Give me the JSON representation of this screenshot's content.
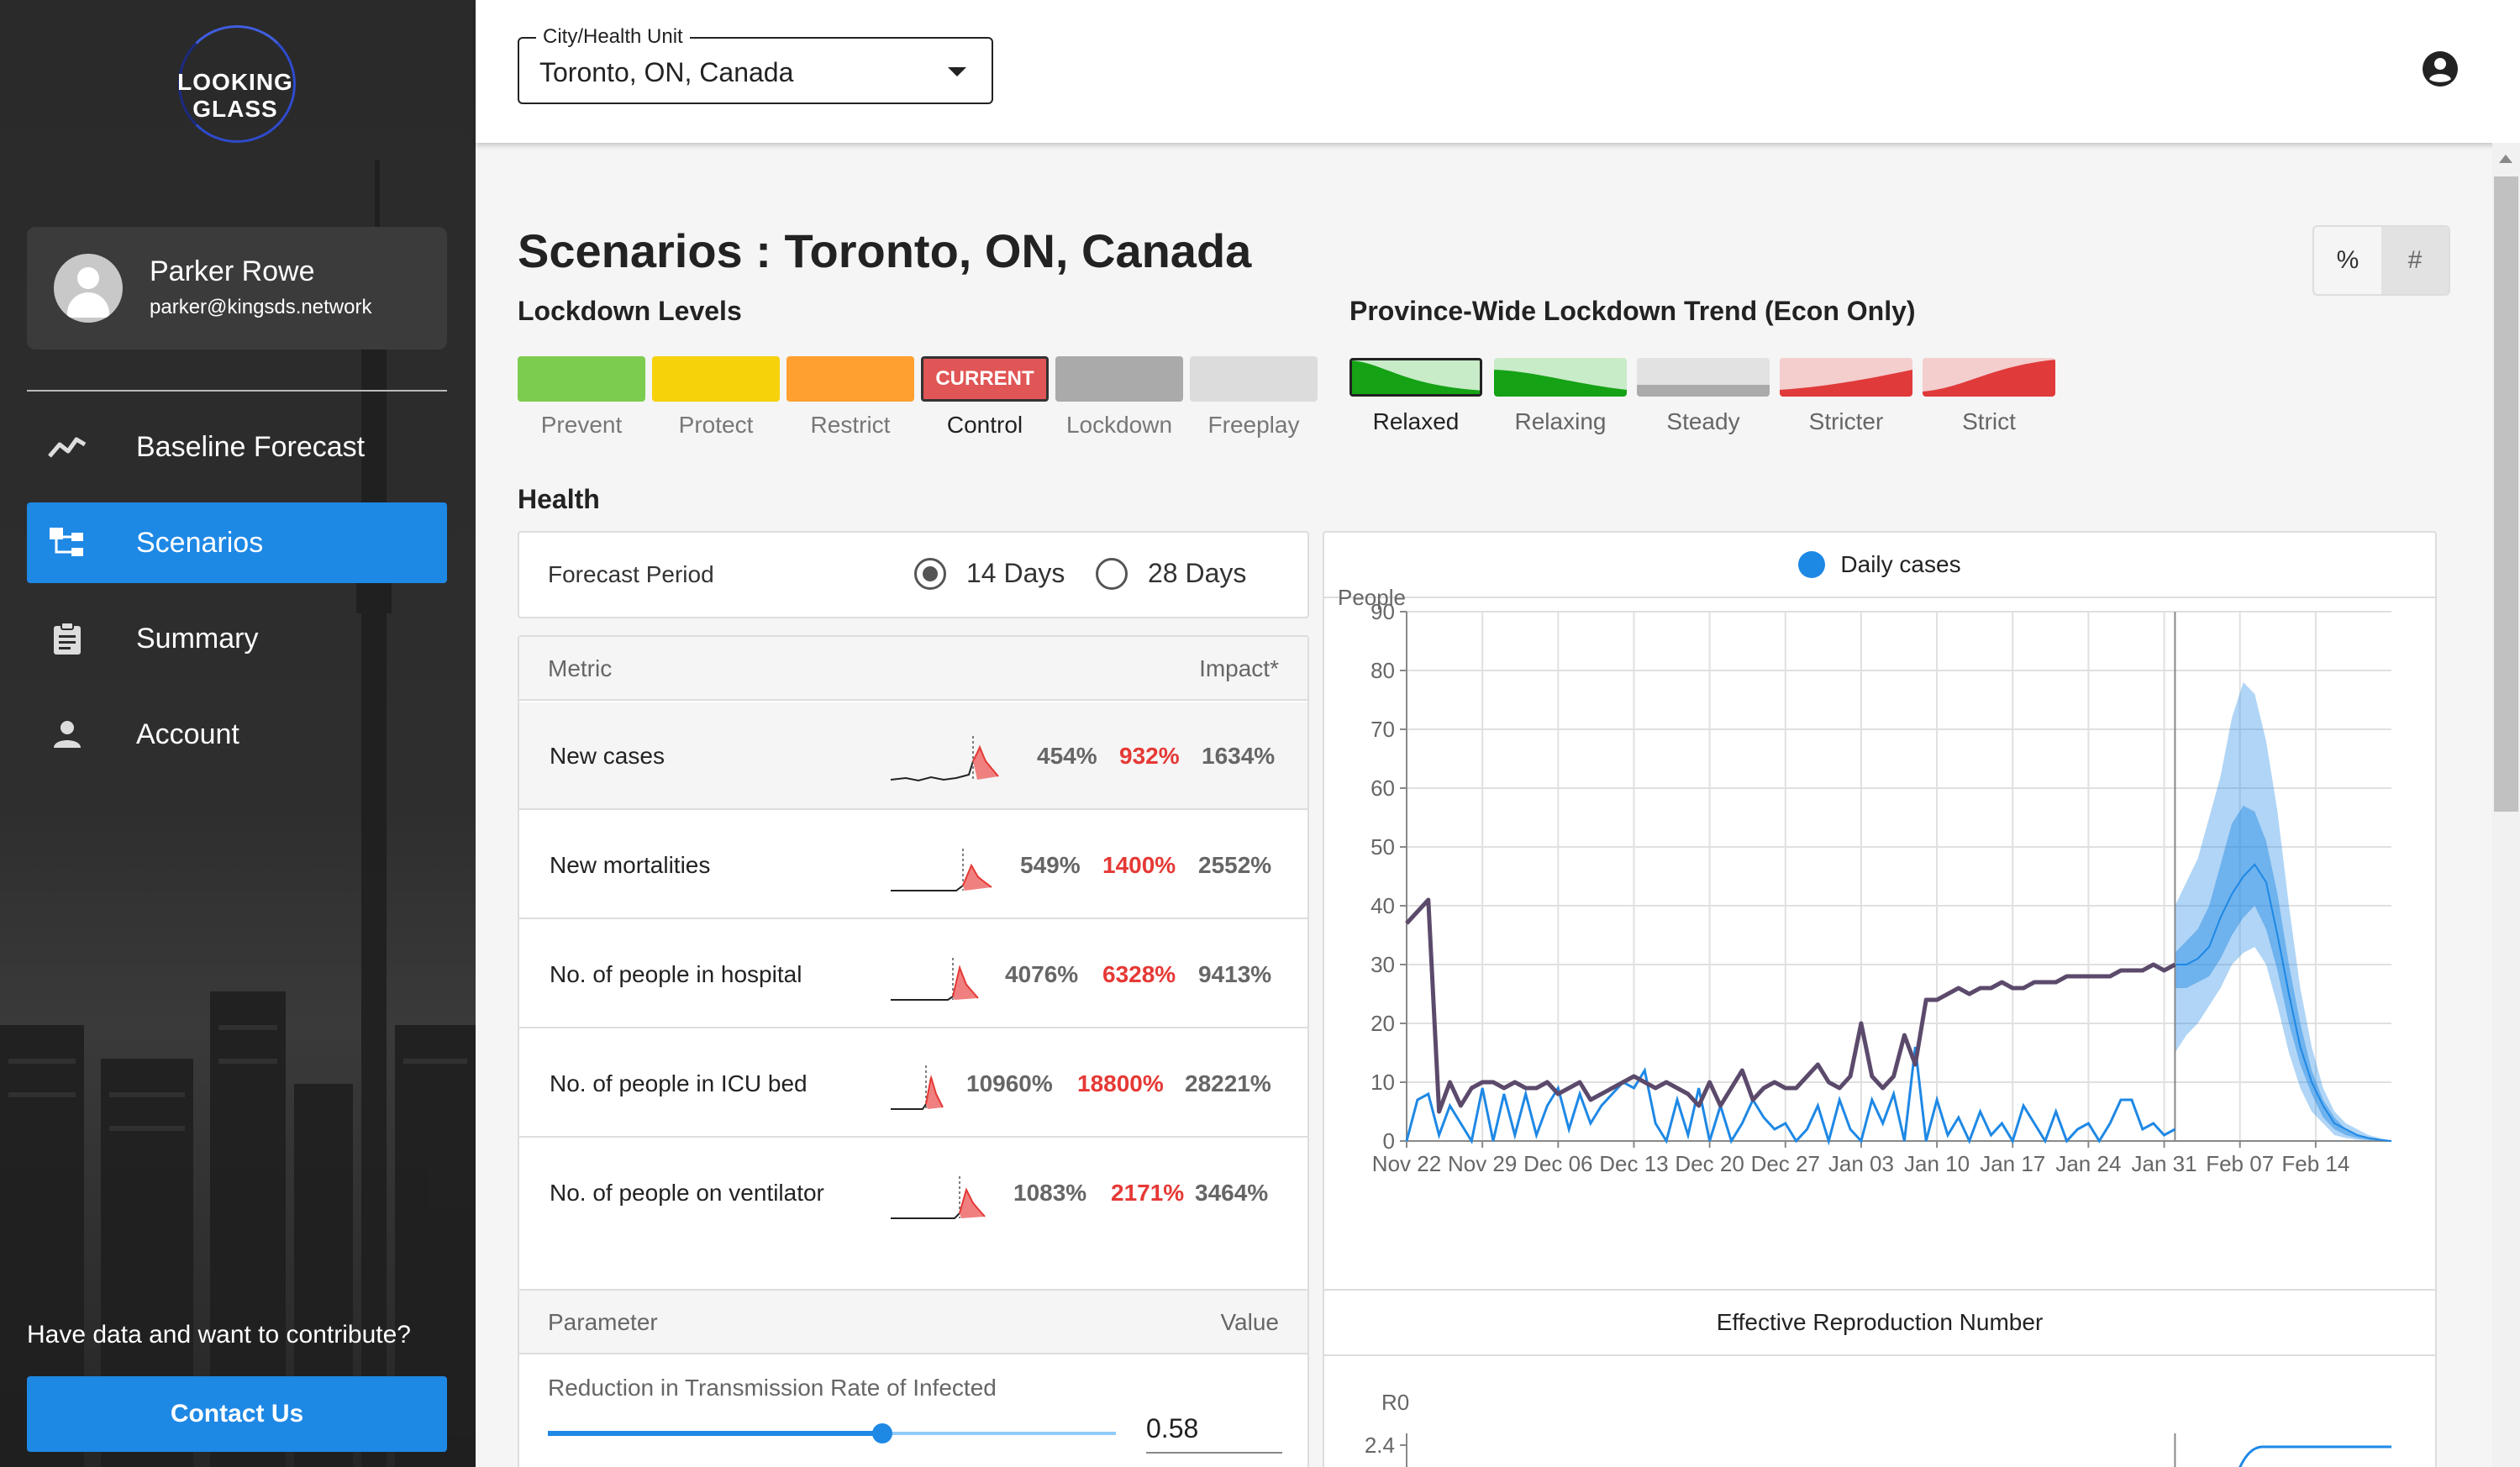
{
  "app": {
    "name": "LOOKING GLASS"
  },
  "user": {
    "name": "Parker Rowe",
    "email": "parker@kingsds.network"
  },
  "nav": [
    {
      "label": "Baseline Forecast",
      "icon": "trend-icon"
    },
    {
      "label": "Scenarios",
      "icon": "scenarios-icon",
      "active": true
    },
    {
      "label": "Summary",
      "icon": "clipboard-icon"
    },
    {
      "label": "Account",
      "icon": "person-icon"
    }
  ],
  "footer": {
    "contribute": "Have data and want to contribute?",
    "contact": "Contact Us"
  },
  "header": {
    "select_label": "City/Health Unit",
    "select_value": "Toronto, ON, Canada"
  },
  "page": {
    "title": "Scenarios : Toronto, ON, Canada",
    "toggle": {
      "percent": "%",
      "count": "#"
    }
  },
  "lockdown": {
    "label": "Lockdown Levels",
    "current_badge": "CURRENT",
    "levels": [
      {
        "label": "Prevent",
        "color": "#7ccc50"
      },
      {
        "label": "Protect",
        "color": "#f5d20a"
      },
      {
        "label": "Restrict",
        "color": "#ffa030"
      },
      {
        "label": "Control",
        "color": "#e05555",
        "current": true
      },
      {
        "label": "Lockdown",
        "color": "#aaaaaa"
      },
      {
        "label": "Freeplay",
        "color": "#dcdcdc"
      }
    ]
  },
  "trend": {
    "label": "Province-Wide Lockdown Trend (Econ Only)",
    "items": [
      {
        "label": "Relaxed",
        "selected": true
      },
      {
        "label": "Relaxing"
      },
      {
        "label": "Steady"
      },
      {
        "label": "Stricter"
      },
      {
        "label": "Strict"
      }
    ]
  },
  "health": {
    "label": "Health",
    "forecast_period": {
      "label": "Forecast Period",
      "options": [
        "14 Days",
        "28 Days"
      ],
      "selected": "14 Days"
    },
    "table": {
      "col_metric": "Metric",
      "col_impact": "Impact*",
      "rows": [
        {
          "name": "New cases",
          "values": [
            "454%",
            "932%",
            "1634%"
          ]
        },
        {
          "name": "New mortalities",
          "values": [
            "549%",
            "1400%",
            "2552%"
          ]
        },
        {
          "name": "No. of people in hospital",
          "values": [
            "4076%",
            "6328%",
            "9413%"
          ]
        },
        {
          "name": "No. of people in ICU bed",
          "values": [
            "10960%",
            "18800%",
            "28221%"
          ]
        },
        {
          "name": "No. of people on ventilator",
          "values": [
            "1083%",
            "2171%",
            "3464%"
          ]
        }
      ]
    }
  },
  "params": {
    "col_param": "Parameter",
    "col_value": "Value",
    "items": [
      {
        "name": "Reduction in Transmission Rate of Infected",
        "value": "0.58",
        "fraction": 0.58
      }
    ]
  },
  "colors": {
    "accent": "#1e88e5",
    "observed": "#5b4a6b",
    "danger": "#e53935"
  },
  "chart_data": [
    {
      "type": "line",
      "legend": [
        "Daily cases"
      ],
      "ylabel": "People",
      "ylim": [
        0,
        90
      ],
      "yticks": [
        0,
        10,
        20,
        30,
        40,
        50,
        60,
        70,
        80,
        90
      ],
      "xticks": [
        "Nov 22",
        "Nov 29",
        "Dec 06",
        "Dec 13",
        "Dec 20",
        "Dec 27",
        "Jan 03",
        "Jan 10",
        "Jan 17",
        "Jan 24",
        "Jan 31",
        "Feb 07",
        "Feb 14"
      ],
      "series": [
        {
          "name": "",
          "type": "line",
          "values": [
            37,
            39,
            41,
            5,
            10,
            6,
            9,
            10,
            10,
            9,
            10,
            9,
            9,
            10,
            8,
            9,
            10,
            7,
            8,
            9,
            10,
            11,
            10,
            9,
            10,
            9,
            8,
            6,
            10,
            6,
            9,
            12,
            7,
            9,
            10,
            9,
            9,
            11,
            13,
            10,
            9,
            11,
            20,
            11,
            9,
            11,
            18,
            13,
            24,
            24,
            25,
            26,
            25,
            26,
            26,
            27,
            26,
            26,
            27,
            27,
            27,
            28,
            28,
            28,
            28,
            28,
            29,
            29,
            29,
            30,
            29,
            30
          ]
        },
        {
          "name": "Daily cases",
          "type": "line",
          "values": [
            0,
            7,
            8,
            1,
            6,
            3,
            0,
            9,
            0,
            8,
            1,
            8,
            1,
            6,
            9,
            2,
            8,
            3,
            6,
            8,
            10,
            9,
            12,
            3,
            0,
            7,
            1,
            9,
            0,
            6,
            0,
            3,
            7,
            4,
            2,
            3,
            0,
            2,
            6,
            0,
            7,
            2,
            0,
            7,
            3,
            8,
            0,
            16,
            0,
            7,
            1,
            4,
            0,
            5,
            1,
            3,
            0,
            6,
            3,
            0,
            5,
            0,
            2,
            3,
            0,
            3,
            7,
            7,
            2,
            3,
            1,
            2
          ]
        },
        {
          "name": "",
          "type": "band",
          "x_start": 72,
          "median": [
            30,
            30,
            31,
            33,
            38,
            42,
            45,
            47,
            44,
            35,
            25,
            16,
            10,
            6,
            3,
            2,
            1,
            0.5,
            0.2,
            0
          ],
          "inner_low": [
            26,
            26,
            27,
            28,
            31,
            35,
            38,
            40,
            36,
            29,
            20,
            13,
            8,
            4,
            2,
            1,
            0.5,
            0.2,
            0.1,
            0
          ],
          "inner_high": [
            32,
            34,
            36,
            40,
            47,
            54,
            57,
            56,
            51,
            42,
            30,
            20,
            12,
            7,
            4,
            2,
            1,
            0.5,
            0.2,
            0
          ],
          "outer_low": [
            15,
            18,
            20,
            23,
            26,
            30,
            32,
            33,
            30,
            23,
            15,
            9,
            5,
            3,
            1,
            0.5,
            0.2,
            0.1,
            0,
            0
          ],
          "outer_high": [
            40,
            44,
            48,
            55,
            62,
            72,
            78,
            76,
            68,
            56,
            40,
            26,
            16,
            9,
            5,
            3,
            2,
            1,
            0.5,
            0
          ]
        }
      ]
    },
    {
      "type": "line",
      "title": "Effective Reproduction Number",
      "ylabel": "R0",
      "yticks": [
        2.4
      ]
    }
  ]
}
